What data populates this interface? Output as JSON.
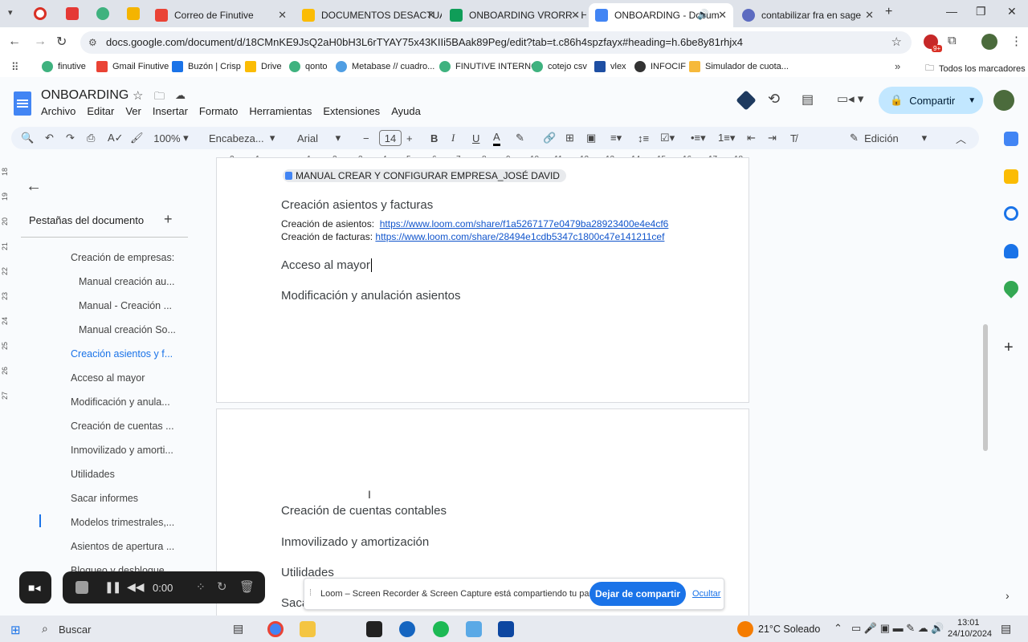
{
  "browser": {
    "tabs": [
      {
        "label": "Correo de Finutive",
        "color": "#ea4335"
      },
      {
        "label": "DOCUMENTOS DESACTUAL",
        "color": "#fbbc04"
      },
      {
        "label": "ONBOARDING VRORR - Ho",
        "color": "#0f9d58"
      },
      {
        "label": "ONBOARDING - Docum",
        "color": "#4285f4"
      },
      {
        "label": "contabilizar fra en sage",
        "color": "#5c6bc0"
      }
    ],
    "url": "docs.google.com/document/d/18CMnKE9JsQ2aH0bH3L6rTYAY75x43KIIi5BAak89Peg/edit?tab=t.c86h4spzfayx#heading=h.6be8y81rhjx4",
    "bookmarks": [
      "finutive",
      "Gmail Finutive",
      "Buzón | Crisp",
      "Drive",
      "qonto",
      "Metabase // cuadro...",
      "FINUTIVE INTERNO",
      "cotejo csv",
      "vlex",
      "INFOCIF",
      "Simulador de cuota..."
    ],
    "bookmarks_all": "Todos los marcadores",
    "ext_badge": "9+"
  },
  "doc": {
    "title": "ONBOARDING",
    "menu": [
      "Archivo",
      "Editar",
      "Ver",
      "Insertar",
      "Formato",
      "Herramientas",
      "Extensiones",
      "Ayuda"
    ],
    "share_label": "Compartir"
  },
  "toolbar": {
    "zoom": "100%",
    "style": "Encabeza...",
    "font": "Arial",
    "size": "14",
    "mode": "Edición"
  },
  "ruler": [
    "2",
    "1",
    "1",
    "2",
    "3",
    "4",
    "5",
    "6",
    "7",
    "8",
    "9",
    "10",
    "11",
    "12",
    "13",
    "14",
    "15",
    "16",
    "17",
    "18"
  ],
  "vruler": [
    "18",
    "19",
    "20",
    "21",
    "22",
    "23",
    "24",
    "25",
    "26",
    "27"
  ],
  "sidebar": {
    "title": "Pestañas del documento",
    "items": [
      {
        "label": "Creación de empresas:"
      },
      {
        "label": "Manual creación au..."
      },
      {
        "label": "Manual - Creación ..."
      },
      {
        "label": "Manual creación So..."
      },
      {
        "label": "Creación asientos y f..."
      },
      {
        "label": "Acceso al mayor"
      },
      {
        "label": "Modificación y anula..."
      },
      {
        "label": "Creación de cuentas ..."
      },
      {
        "label": "Inmovilizado y amorti..."
      },
      {
        "label": "Utilidades"
      },
      {
        "label": "Sacar informes"
      },
      {
        "label": "Modelos trimestrales,..."
      },
      {
        "label": "Asientos de apertura ..."
      },
      {
        "label": "Bloqueo y desbloque..."
      }
    ]
  },
  "content": {
    "chip": "MANUAL CREAR Y CONFIGURAR EMPRESA_JOSÉ DAVID",
    "h_asientos": "Creación asientos y facturas",
    "asientos_label": "Creación de asientos:",
    "asientos_url": "https://www.loom.com/share/f1a5267177e0479ba28923400e4e4cf6",
    "facturas_label": "Creación de facturas:",
    "facturas_url": "https://www.loom.com/share/28494e1cdb5347c1800c47e141211cef",
    "h_mayor": "Acceso al mayor",
    "h_modif": "Modificación y anulación asientos",
    "h_cuentas": "Creación de cuentas contables",
    "h_inmov": "Inmovilizado y amortización",
    "h_util": "Utilidades",
    "h_sacar": "Sacar informes"
  },
  "recorder": {
    "time": "0:00"
  },
  "share_banner": {
    "text": "Loom – Screen Recorder & Screen Capture está compartiendo tu pantalla.",
    "stop": "Dejar de compartir",
    "hide": "Ocultar"
  },
  "taskbar": {
    "search": "Buscar",
    "weather": "21°C  Soleado",
    "time": "13:01",
    "date": "24/10/2024"
  }
}
